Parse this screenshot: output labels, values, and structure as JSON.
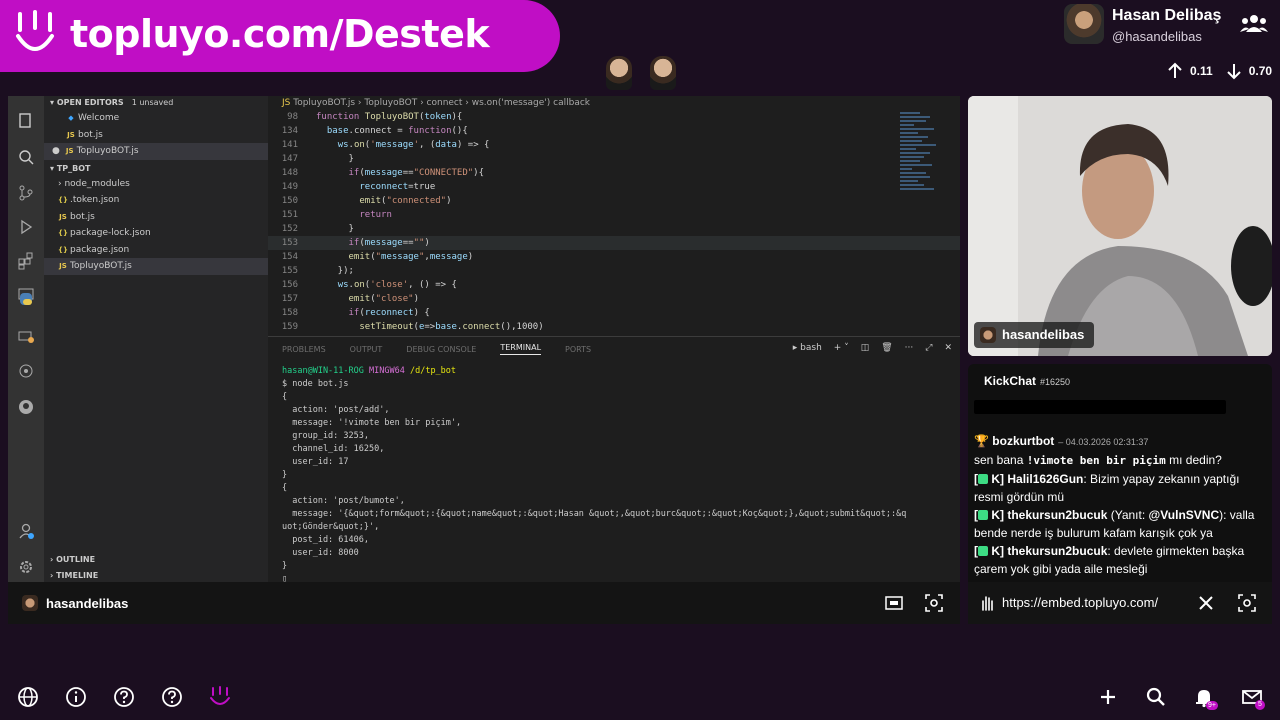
{
  "banner": {
    "text": "topluyo.com/Destek"
  },
  "profile": {
    "name": "Hasan Delibaş",
    "handle": "@hasandelibas",
    "up": "0.11",
    "down": "0.70"
  },
  "ide": {
    "open_editors_label": "OPEN EDITORS",
    "unsaved": "1 unsaved",
    "open_files": [
      "Welcome",
      "bot.js",
      "TopluyoBOT.js"
    ],
    "project": "TP_BOT",
    "files": [
      "node_modules",
      ".token.json",
      "bot.js",
      "package-lock.json",
      "package.json",
      "TopluyoBOT.js"
    ],
    "outline": "OUTLINE",
    "timeline": "TIMELINE",
    "breadcrumb": [
      "TopluyoBOT.js",
      "TopluyoBOT",
      "connect",
      "ws.on('message') callback"
    ],
    "code_lines": [
      {
        "n": "98",
        "t": "function TopluyoBOT(token){"
      },
      {
        "n": "134",
        "t": "  base.connect = function(){"
      },
      {
        "n": "141",
        "t": "    ws.on('message', (data) => {"
      },
      {
        "n": "147",
        "t": "      }"
      },
      {
        "n": "148",
        "t": "      if(message==\"CONNECTED\"){"
      },
      {
        "n": "149",
        "t": "        reconnect=true"
      },
      {
        "n": "150",
        "t": "        emit(\"connected\")"
      },
      {
        "n": "151",
        "t": "        return"
      },
      {
        "n": "152",
        "t": "      }"
      },
      {
        "n": "153",
        "t": "      if(message==\"\")"
      },
      {
        "n": "154",
        "t": "      emit(\"message\",message)"
      },
      {
        "n": "155",
        "t": "    });"
      },
      {
        "n": "156",
        "t": "    ws.on('close', () => {"
      },
      {
        "n": "157",
        "t": "      emit(\"close\")"
      },
      {
        "n": "158",
        "t": "      if(reconnect) {"
      },
      {
        "n": "159",
        "t": "        setTimeout(e=>base.connect(),1000)"
      }
    ],
    "panel_tabs": [
      "PROBLEMS",
      "OUTPUT",
      "DEBUG CONSOLE",
      "TERMINAL",
      "PORTS"
    ],
    "shell": "bash",
    "terminal": {
      "prompt_user": "hasan@WIN-11-ROG",
      "prompt_env": "MINGW64",
      "prompt_dir": "/d/tp_bot",
      "command": "$ node bot.js",
      "lines": [
        "{",
        "  action: 'post/add',",
        "  message: '!vimote ben bir piçim',",
        "  group_id: 3253,",
        "  channel_id: 16250,",
        "  user_id: 17",
        "}",
        "{",
        "  action: 'post/bumote',",
        "  message: '{&quot;form&quot;:{&quot;name&quot;:&quot;Hasan &quot;,&quot;burc&quot;:&quot;Koç&quot;},&quot;submit&quot;:&q",
        "uot;Gönder&quot;}',",
        "  post_id: 61406,",
        "  user_id: 8000",
        "}"
      ]
    },
    "footer_user": "hasandelibas"
  },
  "cam": {
    "label": "hasandelibas"
  },
  "chat": {
    "title": "KickChat",
    "channel": "#16250",
    "messages": [
      {
        "user": "bozkurtbot",
        "time": "– 04.03.2026 02:31:37",
        "pre": "sen bana ",
        "code": "!vimote ben bir piçim",
        "post": " mı dedin?"
      },
      {
        "tag": "[",
        "tag2": "K]",
        "user": "Halil1626Gun",
        "text": ": Bizim yapay zekanın yaptığı resmi gördün mü"
      },
      {
        "tag": "[",
        "tag2": "K]",
        "user": "thekursun2bucuk",
        "reply_pre": " (Yanıt: ",
        "reply_user": "@VulnSVNC",
        "reply_post": "):",
        "text": " valla bende nerde iş bulurum kafam karışık çok ya"
      },
      {
        "tag": "[",
        "tag2": "K]",
        "user": "thekursun2bucuk",
        "text": ": devlete girmekten başka çarem yok gibi yada aile mesleği"
      }
    ],
    "url": "https://embed.topluyo.com/"
  },
  "bottom": {
    "notif_count": "9+",
    "mail_count": "5"
  },
  "colors": {
    "brand": "#c00ec5",
    "bg": "#1b0e20"
  }
}
